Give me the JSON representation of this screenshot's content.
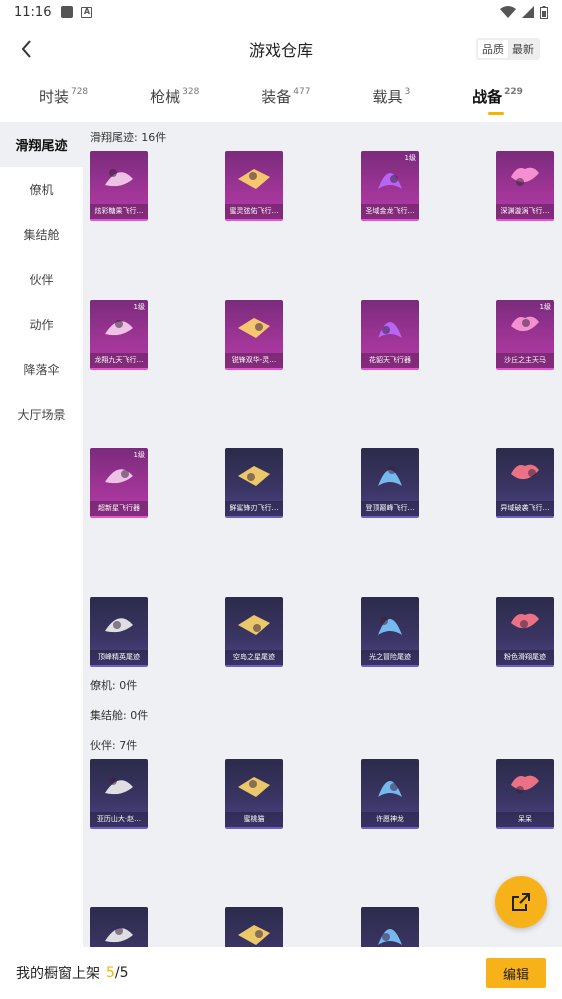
{
  "status": {
    "time": "11:16"
  },
  "header": {
    "title": "游戏仓库",
    "sort": [
      "品质",
      "最新"
    ]
  },
  "tabs": [
    {
      "label": "时装",
      "count": "728"
    },
    {
      "label": "枪械",
      "count": "328"
    },
    {
      "label": "装备",
      "count": "477"
    },
    {
      "label": "载具",
      "count": "3"
    },
    {
      "label": "战备",
      "count": "229"
    }
  ],
  "sidebar": [
    "滑翔尾迹",
    "僚机",
    "集结舱",
    "伙伴",
    "动作",
    "降落伞",
    "大厅场景"
  ],
  "sections": {
    "trail": "滑翔尾迹: 16件",
    "wingman": "僚机: 0件",
    "pod": "集结舱: 0件",
    "partner": "伙伴: 7件"
  },
  "items": [
    {
      "name": "炫彩糖果飞行…",
      "level": "",
      "style": "pink",
      "icon": "candy-glider-icon"
    },
    {
      "name": "蜜灵弦佑飞行…",
      "level": "",
      "style": "pink",
      "icon": "honey-spirit-glider-icon"
    },
    {
      "name": "圣域金龙飞行…",
      "level": "1级",
      "style": "pink",
      "icon": "golden-dragon-glider-icon"
    },
    {
      "name": "深渊漩涡飞行…",
      "level": "",
      "style": "pink",
      "icon": "abyss-vortex-glider-icon"
    },
    {
      "name": "龙翔九天飞行…",
      "level": "1级",
      "style": "pink",
      "icon": "sky-dragon-glider-icon"
    },
    {
      "name": "锐锋双华-灵…",
      "level": "",
      "style": "pink",
      "icon": "twin-blade-glider-icon"
    },
    {
      "name": "花貂天飞行器",
      "level": "",
      "style": "pink",
      "icon": "sable-glider-icon"
    },
    {
      "name": "沙丘之主天马",
      "level": "1级",
      "style": "pink",
      "icon": "dune-pegasus-icon"
    },
    {
      "name": "超新星飞行器",
      "level": "1级",
      "style": "pink",
      "icon": "supernova-glider-icon"
    },
    {
      "name": "鲜鲨锋刃飞行…",
      "level": "",
      "style": "dark",
      "icon": "shark-glider-icon"
    },
    {
      "name": "登顶巅峰飞行…",
      "level": "",
      "style": "dark",
      "icon": "summit-glider-icon"
    },
    {
      "name": "异域破袭飞行…",
      "level": "",
      "style": "dark",
      "icon": "alien-raid-glider-icon"
    },
    {
      "name": "顶峰精英尾迹",
      "level": "",
      "style": "dark",
      "icon": "elite-trail-icon"
    },
    {
      "name": "空岛之星尾迹",
      "level": "",
      "style": "dark",
      "icon": "sky-island-trail-icon"
    },
    {
      "name": "光之冒险尾迹",
      "level": "",
      "style": "dark",
      "icon": "light-adventure-trail-icon"
    },
    {
      "name": "粉色滑翔尾迹",
      "level": "",
      "style": "dark",
      "icon": "pink-glide-trail-icon"
    }
  ],
  "partners": [
    {
      "name": "亚历山大·赵…",
      "style": "dark",
      "icon": "tiger-partner-icon"
    },
    {
      "name": "蜜桃猫",
      "style": "dark",
      "icon": "peach-cat-icon"
    },
    {
      "name": "许愿神龙",
      "style": "dark",
      "icon": "wish-dragon-icon"
    },
    {
      "name": "呆呆",
      "style": "dark",
      "icon": "chick-partner-icon"
    },
    {
      "name": "",
      "style": "dark",
      "icon": "chicken-partner-icon"
    },
    {
      "name": "",
      "style": "dark",
      "icon": "pig-partner-icon"
    },
    {
      "name": "",
      "style": "dark",
      "icon": "knight-partner-icon"
    }
  ],
  "bottom": {
    "label": "我的橱窗上架",
    "current": "5",
    "total": "/5",
    "edit": "编辑"
  },
  "colors": {
    "accent": "#f7b21a",
    "pink_card": "#a03597",
    "dark_card": "#3a3564",
    "content_bg": "#eef0f4"
  }
}
